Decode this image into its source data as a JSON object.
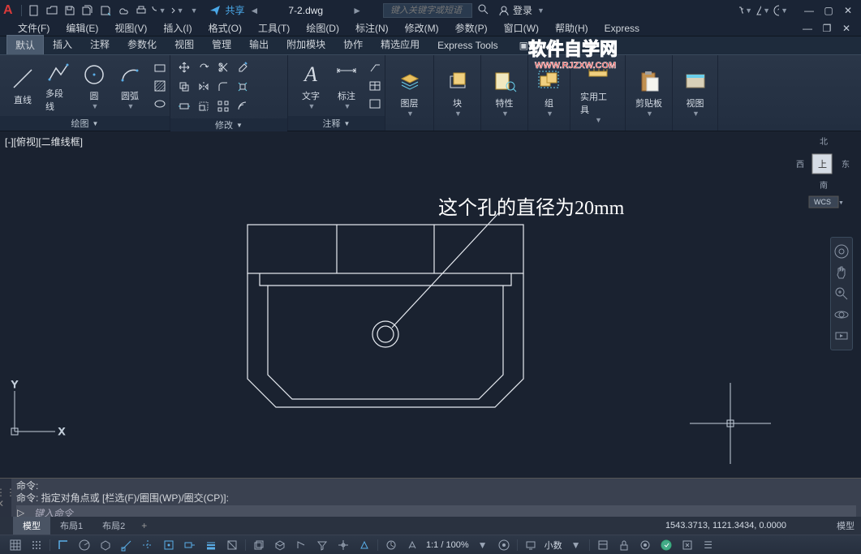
{
  "title": {
    "filename": "7-2.dwg",
    "share": "共享",
    "search_placeholder": "键入关键字或短语",
    "login": "登录"
  },
  "menubar": [
    "文件(F)",
    "编辑(E)",
    "视图(V)",
    "插入(I)",
    "格式(O)",
    "工具(T)",
    "绘图(D)",
    "标注(N)",
    "修改(M)",
    "参数(P)",
    "窗口(W)",
    "帮助(H)",
    "Express"
  ],
  "ribbon_tabs": [
    "默认",
    "插入",
    "注释",
    "参数化",
    "视图",
    "管理",
    "输出",
    "附加模块",
    "协作",
    "精选应用",
    "Express Tools"
  ],
  "panels": {
    "draw": {
      "title": "绘图",
      "btns": {
        "line": "直线",
        "pline": "多段线",
        "circle": "圆",
        "arc": "圆弧"
      }
    },
    "modify": {
      "title": "修改"
    },
    "annot": {
      "title": "注释",
      "btns": {
        "text": "文字",
        "dim": "标注"
      }
    },
    "layer": {
      "title": "图层"
    },
    "block": {
      "title": "块"
    },
    "prop": {
      "title": "特性"
    },
    "group": {
      "title": "组"
    },
    "util": {
      "title": "实用工具"
    },
    "clip": {
      "title": "剪贴板"
    },
    "view": {
      "title": "视图"
    }
  },
  "view_label": "[-][俯视][二维线框]",
  "viewcube": {
    "n": "北",
    "s": "南",
    "e": "东",
    "w": "西",
    "top": "上",
    "wcs": "WCS"
  },
  "annotation": "这个孔的直径为20mm",
  "cmdline": {
    "l1": "命令:",
    "l2": "命令: 指定对角点或 [栏选(F)/圈围(WP)/圈交(CP)]:",
    "prompt": "键入命令"
  },
  "model_tabs": {
    "model": "模型",
    "layout1": "布局1",
    "layout2": "布局2"
  },
  "coords": "1543.3713, 1121.3434, 0.0000",
  "status": {
    "model": "模型",
    "scale": "1:1 / 100%",
    "dec": "小数"
  },
  "watermark": {
    "l1": "软件自学网",
    "l2": "WWW.RJZXW.COM"
  }
}
